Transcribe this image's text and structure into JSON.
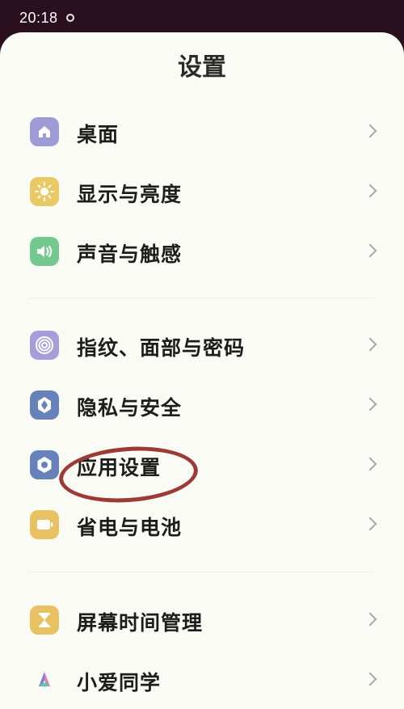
{
  "status_bar": {
    "time": "20:18"
  },
  "page_title": "设置",
  "items": [
    {
      "label": "桌面",
      "icon": "home-icon",
      "color": "#9f9bd6"
    },
    {
      "label": "显示与亮度",
      "icon": "sun-icon",
      "color": "#e9c963"
    },
    {
      "label": "声音与触感",
      "icon": "speaker-icon",
      "color": "#73c98e"
    },
    {
      "label": "指纹、面部与密码",
      "icon": "fingerprint-icon",
      "color": "#a59ed8"
    },
    {
      "label": "隐私与安全",
      "icon": "privacy-shield-icon",
      "color": "#6781ba"
    },
    {
      "label": "应用设置",
      "icon": "gear-hexagon-icon",
      "color": "#6781ba"
    },
    {
      "label": "省电与电池",
      "icon": "battery-icon",
      "color": "#e8c163"
    },
    {
      "label": "屏幕时间管理",
      "icon": "hourglass-icon",
      "color": "#e8c163"
    },
    {
      "label": "小爱同学",
      "icon": "xiaoai-logo-icon",
      "color": "#ffffff"
    }
  ],
  "accent": {
    "highlight_color": "#9c3a36"
  }
}
